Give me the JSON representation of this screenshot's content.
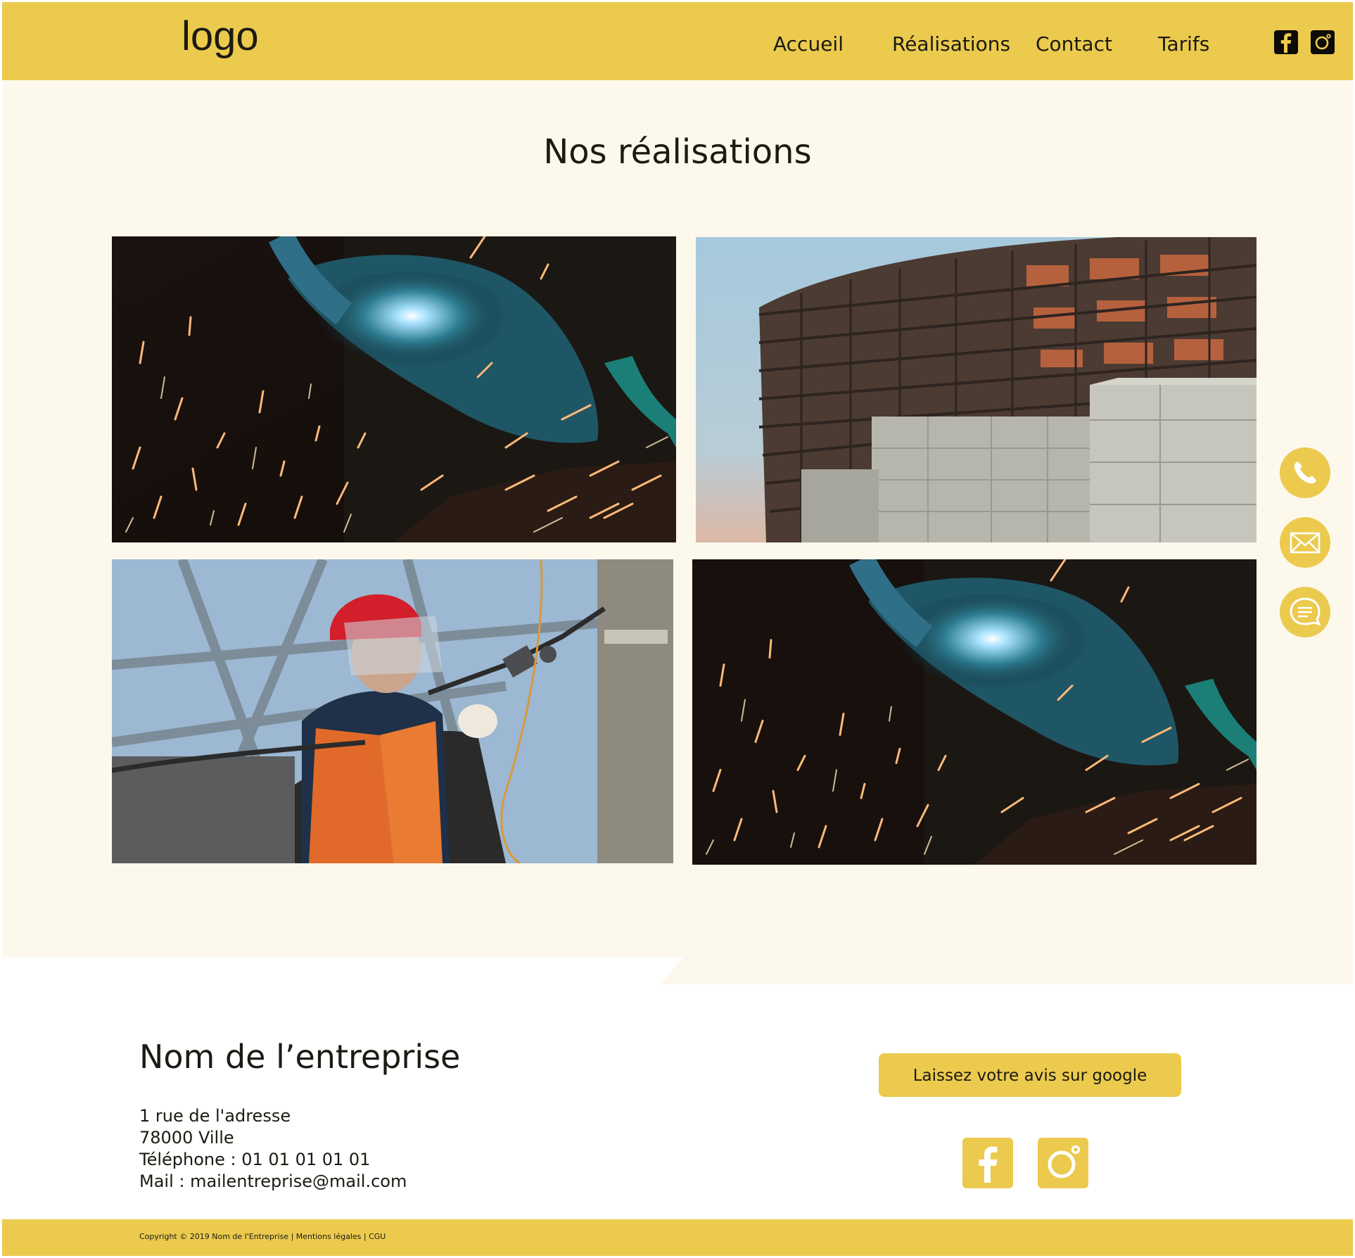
{
  "header": {
    "logo": "logo",
    "nav": [
      "Accueil",
      "Réalisations",
      "Contact",
      "Tarifs"
    ],
    "social_icons": [
      "facebook-icon",
      "instagram-icon"
    ]
  },
  "main": {
    "title": "Nos réalisations",
    "gallery": [
      "welding-photo",
      "building-construction-photo",
      "electrician-photo",
      "welding-photo"
    ],
    "quick_actions": [
      "phone-icon",
      "mail-icon",
      "chat-icon"
    ]
  },
  "footer": {
    "company_name": "Nom de l’entreprise",
    "address_line1": "1 rue de l'adresse",
    "address_line2": "78000 Ville",
    "phone": "Téléphone : 01 01 01 01 01",
    "mail": "Mail : mailentreprise@mail.com",
    "review_button": "Laissez votre avis sur google",
    "social_icons": [
      "facebook-icon",
      "instagram-icon"
    ],
    "copyright": "Copyright © 2019 Nom de l'Entreprise | Mentions légales | CGU"
  },
  "colors": {
    "accent": "#ebca4e",
    "background": "#fdf8ec",
    "text": "#1c1a12"
  }
}
